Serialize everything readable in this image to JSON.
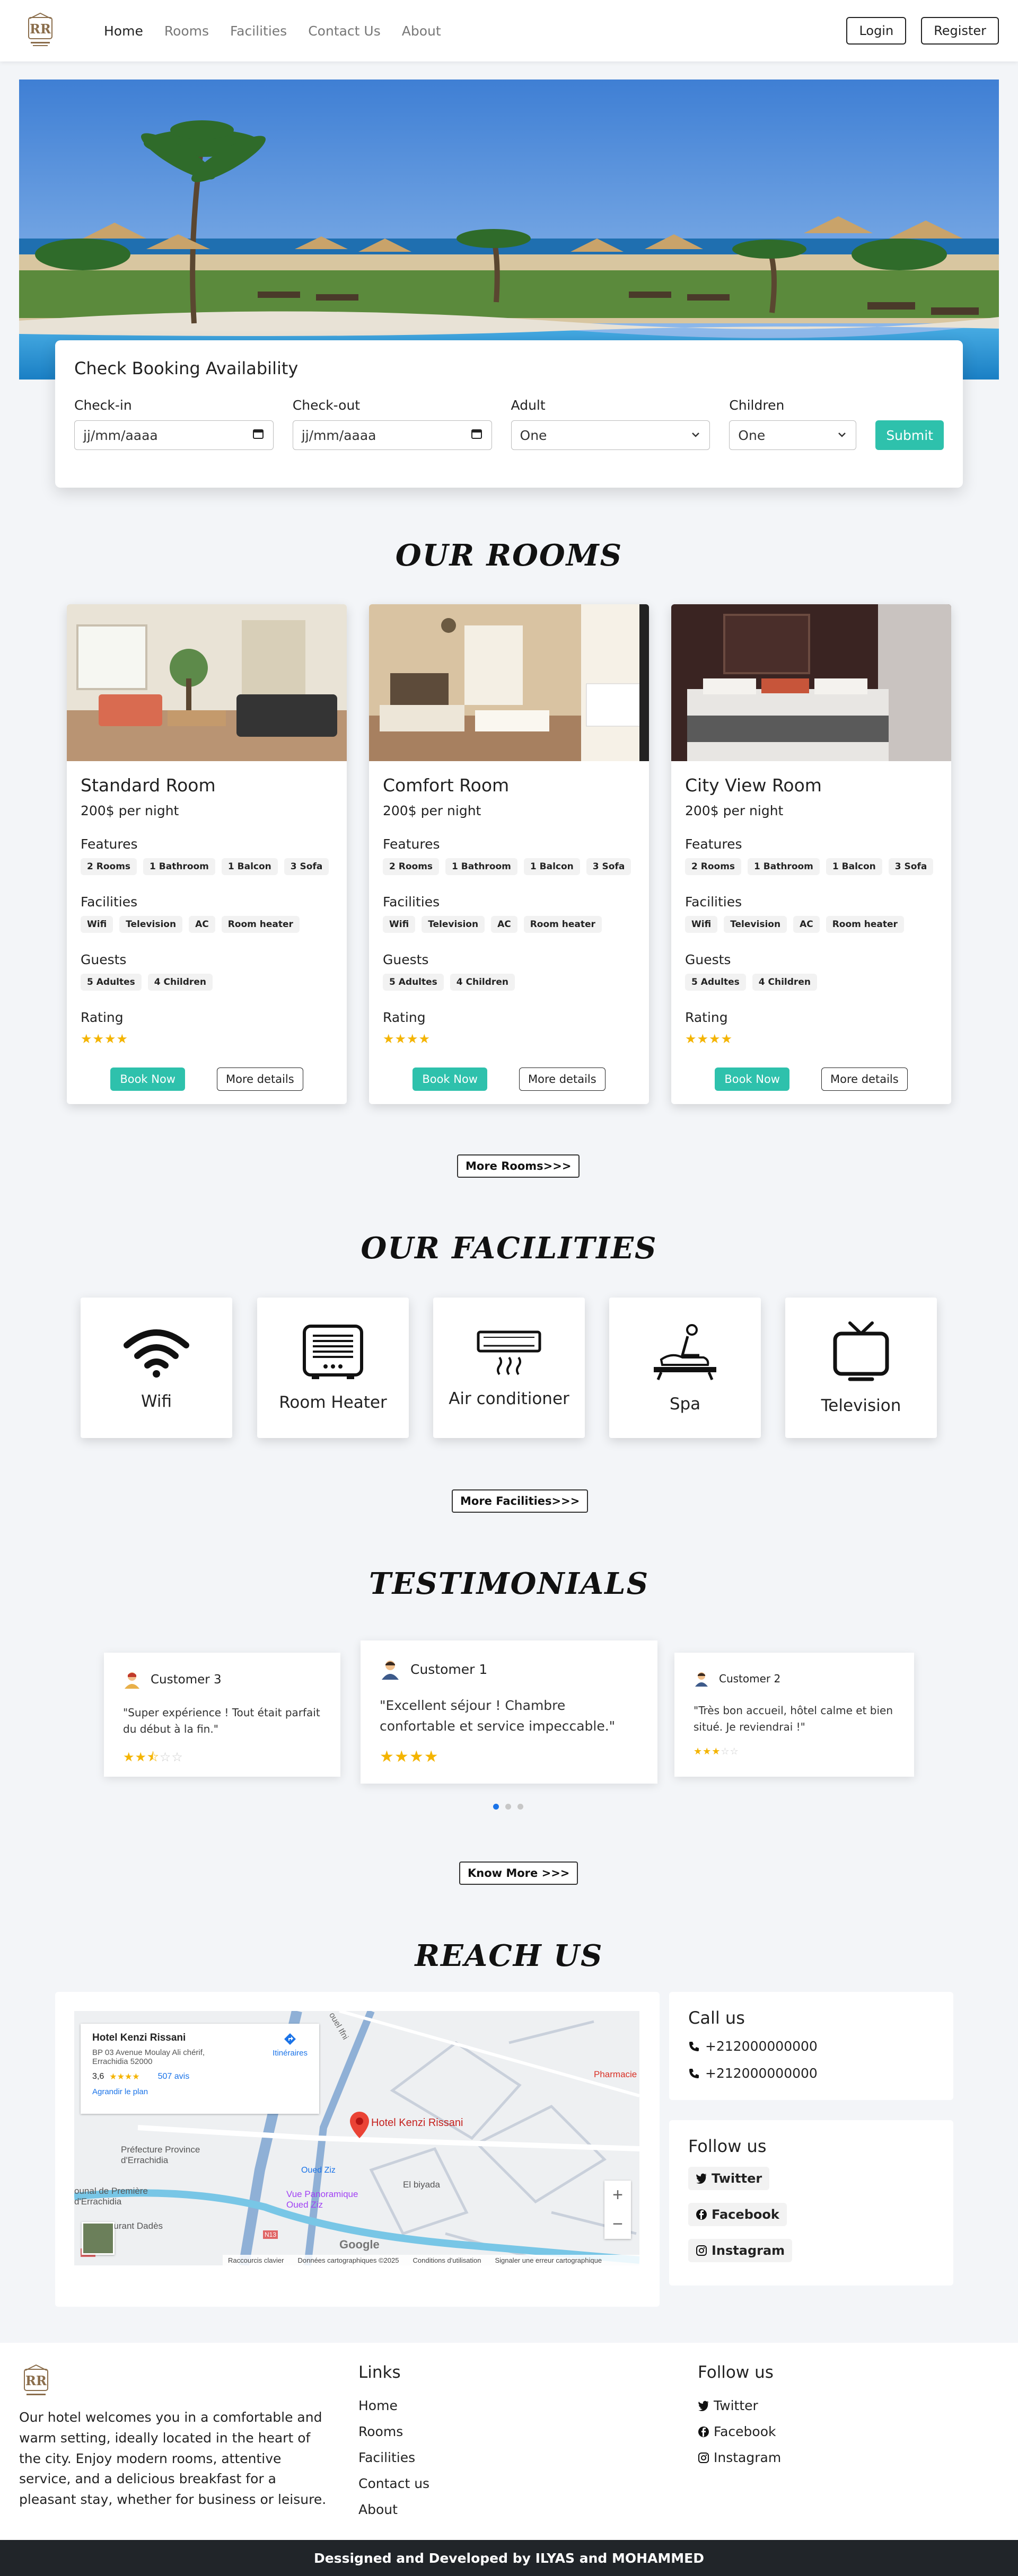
{
  "nav": {
    "links": [
      "Home",
      "Rooms",
      "Facilities",
      "Contact Us",
      "About"
    ],
    "login": "Login",
    "register": "Register"
  },
  "booking": {
    "title": "Check Booking Availability",
    "checkin_label": "Check-in",
    "checkin_placeholder": "jj/mm/aaaa",
    "checkout_label": "Check-out",
    "checkout_placeholder": "jj/mm/aaaa",
    "adult_label": "Adult",
    "adult_value": "One",
    "children_label": "Children",
    "children_value": "One",
    "submit": "Submit"
  },
  "rooms": {
    "title": "OUR ROOMS",
    "features_label": "Features",
    "facilities_label": "Facilities",
    "guests_label": "Guests",
    "rating_label": "Rating",
    "book_label": "Book Now",
    "details_label": "More details",
    "items": [
      {
        "name": "Standard Room",
        "price": "200$ per night",
        "features": [
          "2 Rooms",
          "1 Bathroom",
          "1 Balcon",
          "3 Sofa"
        ],
        "facilities": [
          "Wifi",
          "Television",
          "AC",
          "Room heater"
        ],
        "guests": [
          "5 Adultes",
          "4 Children"
        ],
        "rating": 4
      },
      {
        "name": "Comfort Room",
        "price": "200$ per night",
        "features": [
          "2 Rooms",
          "1 Bathroom",
          "1 Balcon",
          "3 Sofa"
        ],
        "facilities": [
          "Wifi",
          "Television",
          "AC",
          "Room heater"
        ],
        "guests": [
          "5 Adultes",
          "4 Children"
        ],
        "rating": 4
      },
      {
        "name": "City View Room",
        "price": "200$ per night",
        "features": [
          "2 Rooms",
          "1 Bathroom",
          "1 Balcon",
          "3 Sofa"
        ],
        "facilities": [
          "Wifi",
          "Television",
          "AC",
          "Room heater"
        ],
        "guests": [
          "5 Adultes",
          "4 Children"
        ],
        "rating": 4
      }
    ],
    "more": "More Rooms>>>"
  },
  "facilities": {
    "title": "OUR FACILITIES",
    "items": [
      "Wifi",
      "Room Heater",
      "Air conditioner",
      "Spa",
      "Television"
    ],
    "more": "More Facilities>>>"
  },
  "testimonials": {
    "title": "TESTIMONIALS",
    "items": [
      {
        "name": "Customer 3",
        "quote": "\"Super expérience ! Tout était parfait du début à la fin.\"",
        "rating": 2.5
      },
      {
        "name": "Customer 1",
        "quote": "\"Excellent séjour ! Chambre confortable et service impeccable.\"",
        "rating": 4
      },
      {
        "name": "Customer 2",
        "quote": "\"Très bon accueil, hôtel calme et bien situé. Je reviendrai !\"",
        "rating": 3
      }
    ],
    "more": "Know More >>>"
  },
  "reach": {
    "title": "REACH US",
    "map": {
      "place": "Hotel Kenzi Rissani",
      "address_1": "BP 03 Avenue Moulay Ali chérif,",
      "address_2": "Errachidia 52000",
      "rating": "3,6",
      "reviews": "507 avis",
      "enlarge": "Agrandir le plan",
      "directions": "Itinéraires",
      "pin_label": "Hotel Kenzi Rissani",
      "poi_1a": "Préfecture Province",
      "poi_1b": "d'Errachidia",
      "poi_2a": "Vue Panoramique",
      "poi_2b": "Oued Ziz",
      "poi_3": "El biyada",
      "poi_4a": "ounal de Première",
      "poi_4b": "d'Errachidia",
      "poi_5": "Restaurant Dadès",
      "poi_6": "Pharmacie",
      "road_1": "Oued Ziz",
      "road_2": "N13",
      "road_3": "N10",
      "road_4": "ouel Ifni",
      "footer": [
        "Raccourcis clavier",
        "Données cartographiques ©2025",
        "Conditions d'utilisation",
        "Signaler une erreur cartographique"
      ],
      "google": "Google"
    },
    "call_title": "Call us",
    "phones": [
      "+212000000000",
      "+212000000000"
    ],
    "follow_title": "Follow us",
    "social": [
      "Twitter",
      "Facebook",
      "Instagram"
    ]
  },
  "footer": {
    "about": "Our hotel welcomes you in a comfortable and warm setting, ideally located in the heart of the city. Enjoy modern rooms, attentive service, and a delicious breakfast for a pleasant stay, whether for business or leisure.",
    "links_title": "Links",
    "links": [
      "Home",
      "Rooms",
      "Facilities",
      "Contact us",
      "About"
    ],
    "follow_title": "Follow us",
    "social": [
      "Twitter",
      "Facebook",
      "Instagram"
    ],
    "credits": "Dessigned and Developed by ILYAS and MOHAMMED"
  },
  "colors": {
    "accent": "#2ec1ac",
    "star": "#f4b400",
    "dark": "#212529"
  }
}
